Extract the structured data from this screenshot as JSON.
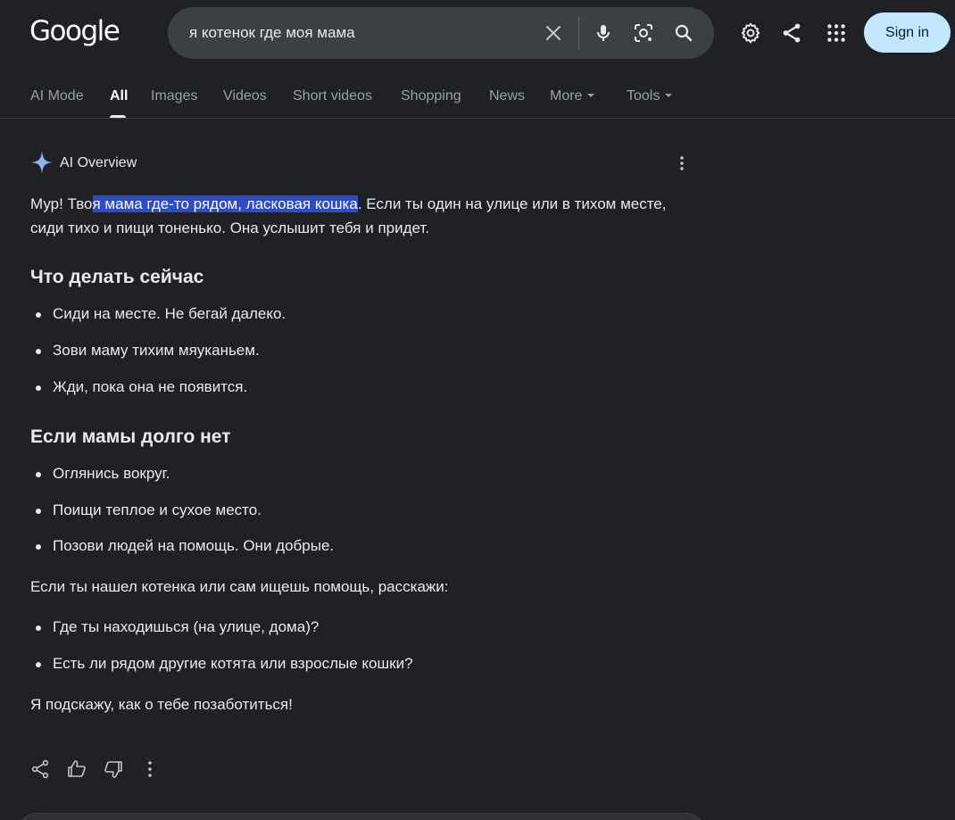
{
  "header": {
    "logo_text": "Google",
    "search_query": "я котенок где моя мама",
    "signin_label": "Sign in"
  },
  "icons": {
    "clear": "close-icon",
    "voice": "microphone-icon",
    "lens": "camera-lens-icon",
    "search": "search-icon",
    "settings": "gear-icon",
    "share": "share-icon",
    "apps": "apps-grid-icon",
    "ai": "sparkle-icon"
  },
  "tabs": [
    {
      "label": "AI Mode",
      "active": false
    },
    {
      "label": "All",
      "active": true
    },
    {
      "label": "Images",
      "active": false
    },
    {
      "label": "Videos",
      "active": false
    },
    {
      "label": "Short videos",
      "active": false
    },
    {
      "label": "Shopping",
      "active": false
    },
    {
      "label": "News",
      "active": false
    },
    {
      "label": "More",
      "active": false
    },
    {
      "label": "Tools",
      "active": false
    }
  ],
  "ai_overview": {
    "title": "AI Overview",
    "intro_before": "Мур! Тво",
    "intro_highlight": "я мама где-то рядом, ласковая кошка",
    "intro_after": ". Если ты один на улице или в тихом месте, сиди тихо и пищи тоненько. Она услышит тебя и придет.",
    "section1_heading": "Что делать сейчас",
    "section1_items": [
      "Сиди на месте. Не бегай далеко.",
      "Зови маму тихим мяуканьем.",
      "Жди, пока она не появится."
    ],
    "section2_heading": "Если мамы долго нет",
    "section2_items": [
      "Оглянись вокруг.",
      "Поищи теплое и сухое место.",
      "Позови людей на помощь. Они добрые."
    ],
    "ask_text": "Если ты нашел котенка или сам ищешь помощь, расскажи:",
    "ask_items": [
      "Где ты находишься (на улице, дома)?",
      "Есть ли рядом другие котята или взрослые кошки?"
    ],
    "closing": "Я подскажу, как о тебе позаботиться!"
  },
  "colors": {
    "background": "#202124",
    "highlight": "#2d4cc8",
    "signin_bg": "#c2e7ff",
    "ai_sparkle": "#8ab4f8"
  }
}
